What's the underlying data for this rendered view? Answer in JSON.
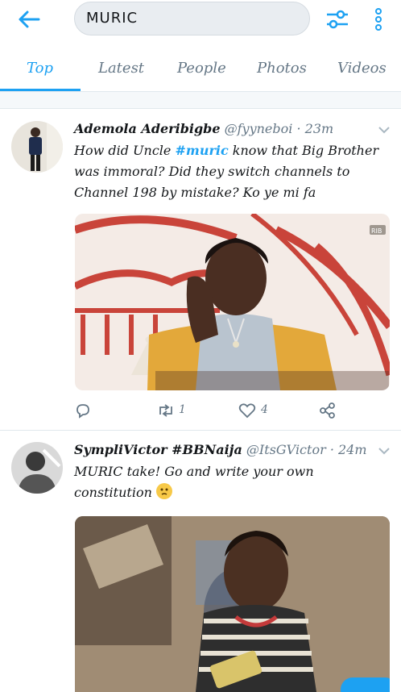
{
  "search": {
    "query": "MURIC"
  },
  "tabs": [
    {
      "label": "Top"
    },
    {
      "label": "Latest"
    },
    {
      "label": "People"
    },
    {
      "label": "Photos"
    },
    {
      "label": "Videos"
    }
  ],
  "tweets": [
    {
      "name": "Ademola Aderibigbe",
      "handle": "@fyyneboi",
      "time": "· 23m",
      "text_pre": "How did Uncle ",
      "hashtag": "#muric",
      "text_post": " know that Big Brother was immoral? Did they switch channels to Channel 198 by mistake? Ko ye mi fa",
      "media_badge": "RIB",
      "retweets": "1",
      "likes": "4"
    },
    {
      "name": "SympliVictor #BBNaija",
      "handle": "@ItsGVictor",
      "time": "· 24m",
      "text": "MURIC take! Go and write your own constitution"
    }
  ],
  "colors": {
    "accent": "#1da1f2",
    "muted": "#657786"
  },
  "icons": [
    "back-arrow-icon",
    "filter-icon",
    "more-vertical-icon",
    "chevron-down-icon",
    "reply-icon",
    "retweet-icon",
    "like-icon",
    "share-icon",
    "thinking-emoji-icon"
  ]
}
